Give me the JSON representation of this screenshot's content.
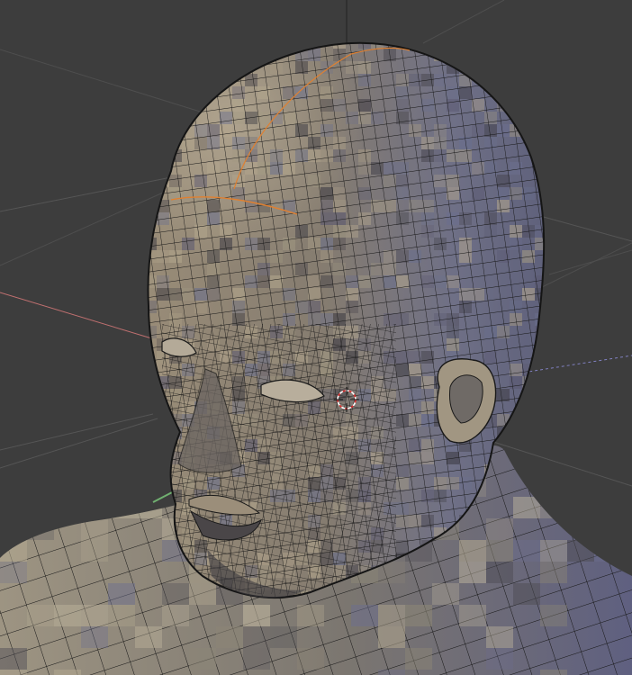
{
  "viewport": {
    "kind": "3d-viewport",
    "mode": "edit-mesh",
    "shading": "solid-wireframe-overlay",
    "object": "head-bust-mesh"
  },
  "colors": {
    "background": "#3d3d3d",
    "grid_line": "#4e4e4e",
    "grid_line_faint": "#555555",
    "axis_x": "#c07070",
    "axis_y": "#70b070",
    "axis_z_dashed": "#8080c0",
    "selection_edge": "#e08030",
    "cursor_red": "#e03030",
    "cursor_white": "#ffffff",
    "mesh_warm": "#8e8272",
    "mesh_cool": "#6e7088",
    "wire": "#1a1a1a"
  },
  "icons": {
    "cursor": "3d-cursor-icon"
  }
}
